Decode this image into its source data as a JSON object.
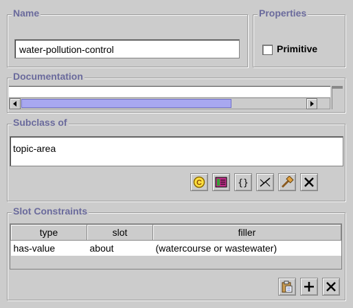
{
  "name_section": {
    "legend": "Name",
    "value": "water-pollution-control"
  },
  "properties_section": {
    "legend": "Properties",
    "primitive_label": "Primitive",
    "primitive_checked": false
  },
  "documentation_section": {
    "legend": "Documentation"
  },
  "subclass_section": {
    "legend": "Subclass of",
    "items": [
      "topic-area"
    ],
    "toolbar_icons": [
      "class-c-icon",
      "slot-table-icon",
      "braces-icon",
      "constraint-icon",
      "hammer-icon",
      "delete-x-icon"
    ]
  },
  "slot_constraints_section": {
    "legend": "Slot Constraints",
    "columns": [
      "type",
      "slot",
      "filler"
    ],
    "rows": [
      {
        "type": "has-value",
        "slot": "about",
        "filler": "(watercourse or wastewater)"
      }
    ],
    "toolbar_icons": [
      "paste-icon",
      "add-plus-icon",
      "delete-x-icon"
    ]
  },
  "colors": {
    "legend": "#6a6a9c",
    "panel": "#cccccc",
    "scroll_thumb": "#a8a8f0"
  }
}
